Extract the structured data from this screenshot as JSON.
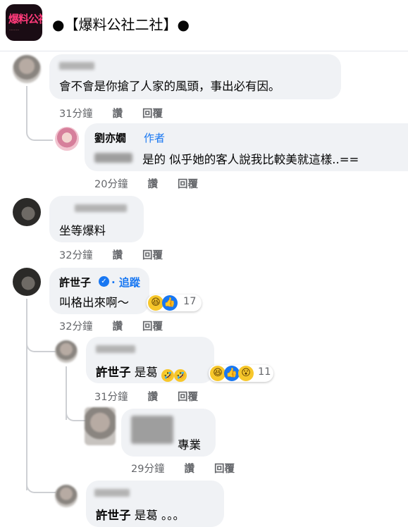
{
  "header": {
    "group_title": "●【爆料公社二社】●",
    "logo_text": "爆料公社"
  },
  "actions": {
    "like": "讚",
    "reply": "回覆"
  },
  "comments": [
    {
      "text": "會不會是你搶了人家的風頭，事出必有因。",
      "time": "31分鐘"
    },
    {
      "name": "劉亦嫺",
      "badge": "作者",
      "text": "是的 似乎她的客人說我比較美就這樣..==",
      "time": "20分鐘"
    },
    {
      "text": "坐等爆料",
      "time": "32分鐘"
    },
    {
      "name": "許世子",
      "follow": "· 追蹤",
      "text": "叫格出來啊～",
      "time": "32分鐘",
      "reaction_count": "17"
    },
    {
      "mention": "許世子",
      "text": " 是葛",
      "time": "31分鐘",
      "reaction_count": "11"
    },
    {
      "text": "專業",
      "time": "29分鐘"
    },
    {
      "mention": "許世子",
      "text": " 是葛 。。。"
    }
  ],
  "icons": [
    "haha-emoji-icon",
    "like-emoji-icon",
    "wow-emoji-icon",
    "verified-badge-icon"
  ],
  "colors": {
    "link": "#1877f2",
    "bubble": "#f0f2f5",
    "meta": "#65676b"
  }
}
